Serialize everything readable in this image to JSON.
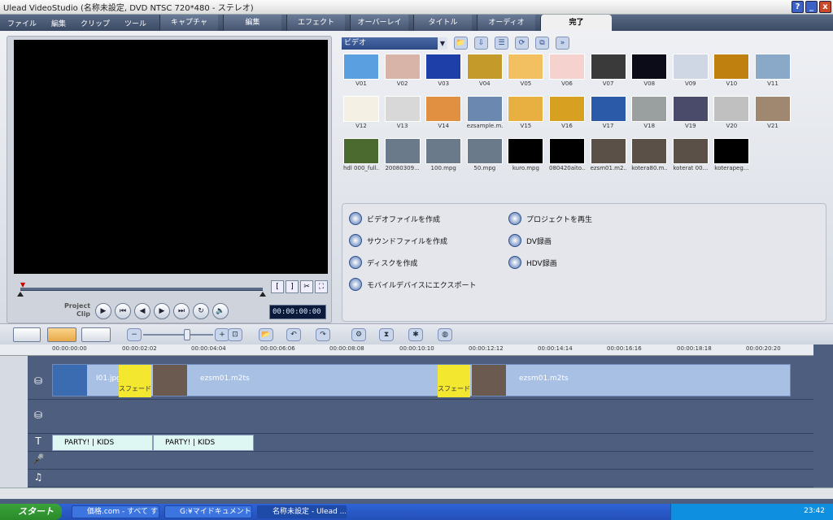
{
  "window": {
    "title": "Ulead VideoStudio (名称未設定, DVD NTSC 720*480 - ステレオ)"
  },
  "menu": [
    "ファイル",
    "編集",
    "クリップ",
    "ツール"
  ],
  "steps": [
    "キャプチャ",
    "編集",
    "エフェクト",
    "オーバーレイ",
    "タイトル",
    "オーディオ",
    "完了"
  ],
  "player": {
    "project_label": "Project",
    "clip_label": "Clip",
    "timecode": "00:00:00:00"
  },
  "library": {
    "selected": "ビデオ"
  },
  "thumbs": [
    {
      "label": "V01",
      "color": "#5aa0e0"
    },
    {
      "label": "V02",
      "color": "#d8b4a8"
    },
    {
      "label": "V03",
      "color": "#1e3ea8"
    },
    {
      "label": "V04",
      "color": "#c49a2a"
    },
    {
      "label": "V05",
      "color": "#f2c060"
    },
    {
      "label": "V06",
      "color": "#f6d2cf"
    },
    {
      "label": "V07",
      "color": "#3a3a3a"
    },
    {
      "label": "V08",
      "color": "#0c0c18"
    },
    {
      "label": "V09",
      "color": "#cfd6e4"
    },
    {
      "label": "V10",
      "color": "#c08010"
    },
    {
      "label": "V11",
      "color": "#8aa8c8"
    },
    {
      "label": "V12",
      "color": "#f4f0e4"
    },
    {
      "label": "V13",
      "color": "#d8d8d8"
    },
    {
      "label": "V14",
      "color": "#e09040"
    },
    {
      "label": "ezsample.m...",
      "color": "#6a88b0"
    },
    {
      "label": "V15",
      "color": "#e8b040"
    },
    {
      "label": "V16",
      "color": "#d8a020"
    },
    {
      "label": "V17",
      "color": "#2a5aa8"
    },
    {
      "label": "V18",
      "color": "#9aa0a0"
    },
    {
      "label": "V19",
      "color": "#4a4a6a"
    },
    {
      "label": "V20",
      "color": "#c0c0c0"
    },
    {
      "label": "V21",
      "color": "#a08870"
    },
    {
      "label": "hdl 000_full...",
      "color": "#4a6a30"
    },
    {
      "label": "20080309...",
      "color": "#6a7a8a"
    },
    {
      "label": "100.mpg",
      "color": "#6a7a8a"
    },
    {
      "label": "50.mpg",
      "color": "#6a7a8a"
    },
    {
      "label": "kuro.mpg",
      "color": "#000000"
    },
    {
      "label": "080420aito...",
      "color": "#000000"
    },
    {
      "label": "ezsm01.m2...",
      "color": "#5a5048"
    },
    {
      "label": "kotera80.m...",
      "color": "#5a5048"
    },
    {
      "label": "koterat 00...",
      "color": "#5a5048"
    },
    {
      "label": "koterapeg...",
      "color": "#000000"
    }
  ],
  "tasks": [
    "ビデオファイルを作成",
    "サウンドファイルを作成",
    "ディスクを作成",
    "モバイルデバイスにエクスポート",
    "プロジェクトを再生",
    "DV録画",
    "HDV録画"
  ],
  "ruler": [
    "00:00:00:00",
    "00:00:02:02",
    "00:00:04:04",
    "00:00:06:06",
    "00:00:08:08",
    "00:00:10:10",
    "00:00:12:12",
    "00:00:14:14",
    "00:00:16:16",
    "00:00:18:18",
    "00:00:20:20"
  ],
  "clips": {
    "jpg": "I01.jpg",
    "fade": "スフェード",
    "m2ts": "ezsm01.m2ts"
  },
  "titles": [
    "PARTY! | KIDS",
    "PARTY! | KIDS"
  ],
  "taskbar": {
    "start": "スタート",
    "items": [
      "価格.com - すべて す...",
      "G:¥マイドキュメント¥My...",
      "名称未設定 - Ulead ..."
    ],
    "clock": "23:42"
  }
}
